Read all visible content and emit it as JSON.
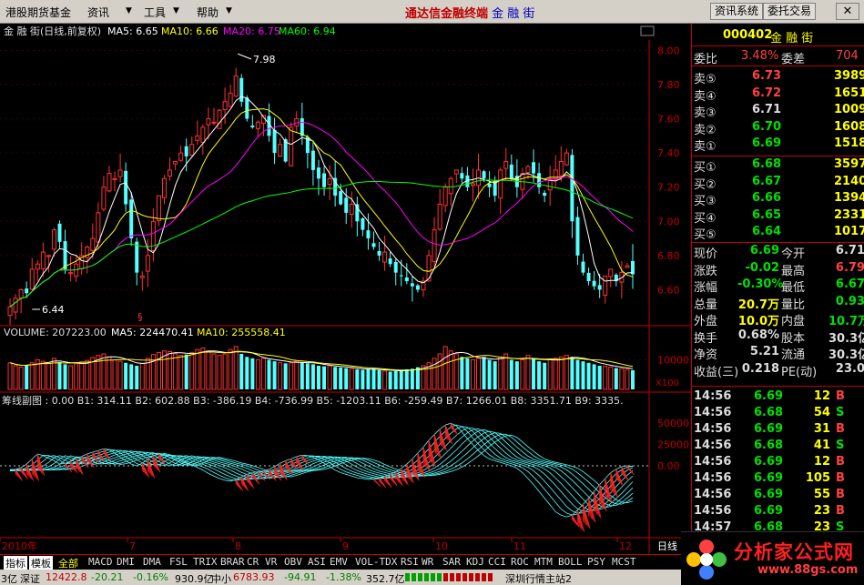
{
  "menu": {
    "items": [
      "港股期货基金",
      "资讯",
      "工具",
      "帮助"
    ],
    "title": "通达信金融终端",
    "stock": "金 融 街",
    "btn_info": "资讯系统",
    "btn_trade": "委托交易"
  },
  "chart": {
    "header": {
      "name": "金 融 街(日线,前复权)",
      "ma5": "MA5: 6.65",
      "ma10": "MA10: 6.66",
      "ma20": "MA20: 6.75",
      "ma60": "MA60: 6.94"
    },
    "price_ticks": [
      "8.00",
      "7.80",
      "7.60",
      "7.40",
      "7.20",
      "7.00",
      "6.80",
      "6.60"
    ],
    "high_label": "7.98",
    "low_label": "6.44",
    "marker": "§",
    "vol_header": {
      "name": "VOLUME: 207223.00",
      "ma5": "MA5: 224470.41",
      "ma10": "MA10: 255558.41"
    },
    "vol_ticks": [
      "10000"
    ],
    "vol_unit": "X100",
    "ind_header": "筹线副图 : 0.00 B1: 314.11 B2: 602.88 B3: -386.19 B4: -736.99 B5: -1203.11 B6: -259.49 B7: 1266.01 B8: 3351.71 B9: 3335.",
    "ind_ticks": [
      "50000",
      "25000",
      "0.00"
    ],
    "x_labels": [
      "2010年",
      "7",
      "8",
      "9",
      "10",
      "11",
      "12"
    ],
    "period": "日线"
  },
  "chart_data": {
    "type": "candlestick",
    "series": [
      {
        "name": "MA5",
        "color": "#ffffff",
        "values": []
      },
      {
        "name": "MA10",
        "color": "#ffff00",
        "values": []
      },
      {
        "name": "MA20",
        "color": "#ff00ff",
        "values": []
      },
      {
        "name": "MA60",
        "color": "#00ff00",
        "values": []
      }
    ],
    "ylim": [
      6.4,
      8.05
    ],
    "close": [
      6.5,
      6.55,
      6.6,
      6.58,
      6.72,
      6.75,
      6.82,
      6.8,
      6.95,
      6.88,
      6.72,
      6.7,
      6.75,
      6.8,
      6.85,
      6.9,
      7.05,
      7.2,
      7.28,
      7.25,
      7.3,
      7.1,
      6.9,
      6.7,
      6.68,
      6.8,
      7.0,
      7.15,
      7.25,
      7.3,
      7.35,
      7.4,
      7.38,
      7.45,
      7.5,
      7.55,
      7.6,
      7.58,
      7.65,
      7.7,
      7.75,
      7.85,
      7.7,
      7.6,
      7.55,
      7.58,
      7.62,
      7.5,
      7.4,
      7.45,
      7.35,
      7.55,
      7.6,
      7.5,
      7.4,
      7.3,
      7.25,
      7.2,
      7.25,
      7.15,
      7.1,
      7.05,
      7.1,
      7.0,
      6.95,
      6.9,
      6.85,
      6.8,
      6.82,
      6.75,
      6.7,
      6.68,
      6.65,
      6.62,
      6.6,
      6.65,
      6.8,
      6.95,
      7.1,
      7.2,
      7.25,
      7.3,
      7.25,
      7.2,
      7.22,
      7.3,
      7.25,
      7.2,
      7.15,
      7.3,
      7.35,
      7.25,
      7.2,
      7.28,
      7.32,
      7.28,
      7.2,
      7.15,
      7.25,
      7.3,
      7.35,
      7.4,
      7.0,
      6.8,
      6.7,
      6.65,
      6.62,
      6.6,
      6.68,
      6.72,
      6.65,
      6.7,
      6.74,
      6.69
    ],
    "volume": [
      9000,
      8000,
      7500,
      8200,
      9000,
      10000,
      9500,
      8800,
      10500,
      9200,
      8500,
      8000,
      8700,
      9300,
      9800,
      10800,
      11500,
      12000,
      11000,
      10000,
      9500,
      9000,
      8500,
      8000,
      8800,
      10500,
      11800,
      12500,
      13000,
      12800,
      12000,
      11500,
      11800,
      12500,
      13500,
      14000,
      13000,
      12000,
      11500,
      12000,
      13500,
      14500,
      12000,
      11000,
      10500,
      10000,
      10500,
      10000,
      9500,
      9000,
      8800,
      9000,
      9500,
      9200,
      8800,
      8500,
      8000,
      7800,
      8000,
      7600,
      7400,
      7200,
      7000,
      6800,
      6600,
      6800,
      7000,
      6500,
      6200,
      6000,
      6200,
      6500,
      6800,
      7000,
      7500,
      8000,
      9000,
      10500,
      12000,
      14500,
      13000,
      12000,
      11000,
      10500,
      10000,
      10500,
      11000,
      10000,
      9500,
      11000,
      12000,
      10000,
      9500,
      10000,
      11500,
      10500,
      9500,
      9000,
      10000,
      10500,
      11000,
      11500,
      11000,
      10000,
      9500,
      9000,
      8500,
      8000,
      7800,
      7500,
      7200,
      7000,
      6800,
      6500
    ],
    "indicator": [
      -6000,
      -4000,
      -2000,
      2000,
      8000,
      14000,
      12000,
      9000,
      6000,
      2000,
      3000,
      5000,
      9000,
      11000,
      14000,
      16000,
      18000,
      20000,
      19000,
      15000,
      10000,
      6000,
      2000,
      0,
      3000,
      8000,
      12000,
      14000,
      12000,
      10000,
      8000,
      5000,
      3000,
      1000,
      -2000,
      -5000,
      -9000,
      -12000,
      -15000,
      -17000,
      -18000,
      -16000,
      -13000,
      -10000,
      -8000,
      -7000,
      -6000,
      -4000,
      -1000,
      3000,
      6000,
      8000,
      11000,
      12500,
      12000,
      10000,
      7000,
      3000,
      -1000,
      -5000,
      -8000,
      -10000,
      -12000,
      -14000,
      -15000,
      -16000,
      -15500,
      -14000,
      -12000,
      -10000,
      -7000,
      -3000,
      2000,
      8000,
      15000,
      22000,
      30000,
      37000,
      43000,
      48000,
      50000,
      47000,
      40000,
      32000,
      25000,
      18000,
      12000,
      8000,
      6000,
      4000,
      2000,
      0,
      -3000,
      -8000,
      -15000,
      -22000,
      -30000,
      -38000,
      -46000,
      -54000,
      -58000,
      -60000,
      -58000,
      -52000,
      -45000,
      -38000,
      -30000,
      -22000,
      -15000,
      -8000,
      -4000,
      -1000,
      0,
      -500
    ]
  },
  "quote": {
    "code": "000402",
    "name": "金 融 街",
    "webi_label": "委比",
    "webi": "3.48%",
    "wecha_label": "委差",
    "wecha": "704",
    "sells": [
      {
        "label": "卖⑤",
        "price": "6.73",
        "vol": "3989"
      },
      {
        "label": "卖④",
        "price": "6.72",
        "vol": "1651"
      },
      {
        "label": "卖③",
        "price": "6.71",
        "vol": "1009"
      },
      {
        "label": "卖②",
        "price": "6.70",
        "vol": "1608"
      },
      {
        "label": "卖①",
        "price": "6.69",
        "vol": "1518"
      }
    ],
    "buys": [
      {
        "label": "买①",
        "price": "6.68",
        "vol": "3597"
      },
      {
        "label": "买②",
        "price": "6.67",
        "vol": "2140"
      },
      {
        "label": "买③",
        "price": "6.66",
        "vol": "1394"
      },
      {
        "label": "买④",
        "price": "6.65",
        "vol": "2331"
      },
      {
        "label": "买⑤",
        "price": "6.64",
        "vol": "1017"
      }
    ],
    "stats": [
      {
        "l1": "现价",
        "v1": "6.69",
        "l2": "今开",
        "v2": "6.71"
      },
      {
        "l1": "涨跌",
        "v1": "-0.02",
        "l2": "最高",
        "v2": "6.79"
      },
      {
        "l1": "涨幅",
        "v1": "-0.30%",
        "l2": "最低",
        "v2": "6.67"
      },
      {
        "l1": "总量",
        "v1": "20.7万",
        "l2": "量比",
        "v2": "0.93"
      },
      {
        "l1": "外盘",
        "v1": "10.0万",
        "l2": "内盘",
        "v2": "10.7万"
      },
      {
        "l1": "换手",
        "v1": "0.68%",
        "l2": "股本",
        "v2": "30.3亿"
      },
      {
        "l1": "净资",
        "v1": "5.21",
        "l2": "流通",
        "v2": "30.3亿"
      },
      {
        "l1": "收益(三)",
        "v1": "0.218",
        "l2": "PE(动)",
        "v2": "23.0"
      }
    ],
    "ticks": [
      {
        "t": "14:56",
        "p": "6.69",
        "v": "12",
        "s": "B"
      },
      {
        "t": "14:56",
        "p": "6.68",
        "v": "54",
        "s": "S"
      },
      {
        "t": "14:56",
        "p": "6.69",
        "v": "31",
        "s": "B"
      },
      {
        "t": "14:56",
        "p": "6.68",
        "v": "41",
        "s": "S"
      },
      {
        "t": "14:56",
        "p": "6.69",
        "v": "12",
        "s": "B"
      },
      {
        "t": "14:56",
        "p": "6.69",
        "v": "105",
        "s": "B"
      },
      {
        "t": "14:56",
        "p": "6.69",
        "v": "55",
        "s": "B"
      },
      {
        "t": "14:56",
        "p": "6.69",
        "v": "23",
        "s": "B"
      },
      {
        "t": "14:57",
        "p": "6.68",
        "v": "23",
        "s": "S"
      }
    ]
  },
  "tabs": [
    "指标",
    "模板",
    "全部",
    "MACD",
    "DMI",
    "DMA",
    "FSL",
    "TRIX",
    "BRAR",
    "CR",
    "VR",
    "OBV",
    "ASI",
    "EMV",
    "VOL-TDX",
    "RSI",
    "WR",
    "SAR",
    "KDJ",
    "CCI",
    "ROC",
    "MTM",
    "BOLL",
    "PSY",
    "MCST"
  ],
  "status": {
    "s1": "3亿",
    "s2": "深证",
    "s3": "12422.8",
    "s4": "-20.21",
    "s5": "-0.16%",
    "s6": "930.9亿",
    "s7": "中小",
    "s8": "6783.93",
    "s9": "-94.91",
    "s10": "-1.38%",
    "s11": "352.7亿",
    "s12": "深圳行情主站2"
  },
  "logo": {
    "title": "分析家公式网",
    "url": "www.88gs.com"
  }
}
